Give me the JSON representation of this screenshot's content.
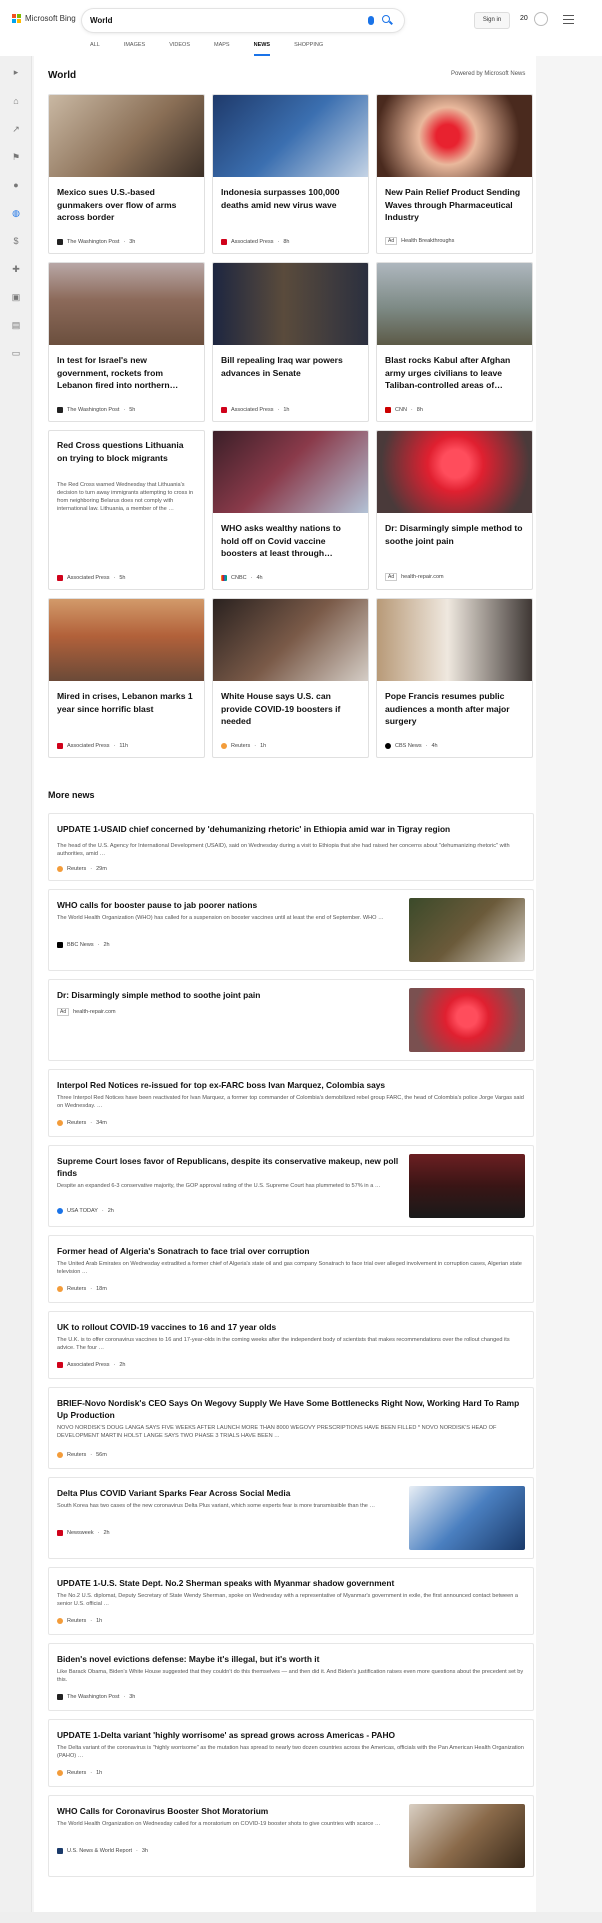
{
  "header": {
    "brand": "Microsoft Bing",
    "query": "World",
    "signin": "Sign in",
    "reward_count": "20"
  },
  "tabs": [
    "ALL",
    "IMAGES",
    "VIDEOS",
    "MAPS",
    "NEWS",
    "SHOPPING"
  ],
  "active_tab": "NEWS",
  "section": {
    "title": "World",
    "powered": "Powered by Microsoft News"
  },
  "cards": [
    {
      "title": "Mexico sues U.S.-based gunmakers over flow of arms across border",
      "source": "The Washington Post",
      "age": "3h",
      "ad": false
    },
    {
      "title": "Indonesia surpasses 100,000 deaths amid new virus wave",
      "source": "Associated Press",
      "age": "8h",
      "ad": false
    },
    {
      "title": "New Pain Relief Product Sending Waves through Pharmaceutical Industry",
      "source": "Health Breakthroughs",
      "age": "",
      "ad": true
    },
    {
      "title": "In test for Israel's new government, rockets from Lebanon fired into northern…",
      "source": "The Washington Post",
      "age": "5h",
      "ad": false
    },
    {
      "title": "Bill repealing Iraq war powers advances in Senate",
      "source": "Associated Press",
      "age": "1h",
      "ad": false
    },
    {
      "title": "Blast rocks Kabul after Afghan army urges civilians to leave Taliban-controlled areas of…",
      "source": "CNN",
      "age": "8h",
      "ad": false
    },
    {
      "title": "Red Cross questions Lithuania on trying to block migrants",
      "snippet": "The Red Cross warned Wednesday that Lithuania's decision to turn away immigrants attempting to cross in from neighboring Belarus does not comply with international law. Lithuania, a member of the …",
      "source": "Associated Press",
      "age": "5h",
      "ad": false
    },
    {
      "title": "WHO asks wealthy nations to hold off on Covid vaccine boosters at least through…",
      "source": "CNBC",
      "age": "4h",
      "ad": false
    },
    {
      "title": "Dr: Disarmingly simple method to soothe joint pain",
      "source": "health-repair.com",
      "age": "",
      "ad": true
    },
    {
      "title": "Mired in crises, Lebanon marks 1 year since horrific blast",
      "source": "Associated Press",
      "age": "11h",
      "ad": false
    },
    {
      "title": "White House says U.S. can provide COVID-19 boosters if needed",
      "source": "Reuters",
      "age": "1h",
      "ad": false
    },
    {
      "title": "Pope Francis resumes public audiences a month after major surgery",
      "source": "CBS News",
      "age": "4h",
      "ad": false
    }
  ],
  "more_title": "More news",
  "news": [
    {
      "title": "UPDATE 1-USAID chief concerned by 'dehumanizing rhetoric' in Ethiopia amid war in Tigray region",
      "snippet": "The head of the U.S. Agency for International Development (USAID), said on Wednesday during a visit to Ethiopia that she had raised her concerns about \"dehumanizing rhetoric\" with authorities, amid …",
      "source": "Reuters",
      "age": "29m"
    },
    {
      "title": "WHO calls for booster pause to jab poorer nations",
      "snippet": "The World Health Organization (WHO) has called for a suspension on booster vaccines until at least the end of September. WHO …",
      "source": "BBC News",
      "age": "2h"
    },
    {
      "title": "Dr: Disarmingly simple method to soothe joint pain",
      "snippet": "",
      "source": "health-repair.com",
      "age": "",
      "ad": true
    },
    {
      "title": "Interpol Red Notices re-issued for top ex-FARC boss Ivan Marquez, Colombia says",
      "snippet": "Three Interpol Red Notices have been reactivated for Ivan Marquez, a former top commander of Colombia's demobilized rebel group FARC, the head of Colombia's police Jorge Vargas said on Wednesday. …",
      "source": "Reuters",
      "age": "34m"
    },
    {
      "title": "Supreme Court loses favor of Republicans, despite its conservative makeup, new poll finds",
      "snippet": "Despite an expanded 6-3 conservative majority, the GOP approval rating of the U.S. Supreme Court has plummeted to 57% in a …",
      "source": "USA TODAY",
      "age": "2h"
    },
    {
      "title": "Former head of Algeria's Sonatrach to face trial over corruption",
      "snippet": "The United Arab Emirates on Wednesday extradited a former chief of Algeria's state oil and gas company Sonatrach to face trial over alleged involvement in corruption cases, Algerian state television …",
      "source": "Reuters",
      "age": "18m"
    },
    {
      "title": "UK to rollout COVID-19 vaccines to 16 and 17 year olds",
      "snippet": "The U.K. is to offer coronavirus vaccines to 16 and 17-year-olds in the coming weeks after the independent body of scientists that makes recommendations over the rollout changed its advice. The four …",
      "source": "Associated Press",
      "age": "2h"
    },
    {
      "title": "BRIEF-Novo Nordisk's CEO Says On Wegovy Supply We Have Some Bottlenecks Right Now, Working Hard To Ramp Up Production",
      "snippet": "NOVO NORDISK'S DOUG LANGA SAYS FIVE WEEKS AFTER LAUNCH MORE THAN 8000 WEGOVY PRESCRIPTIONS HAVE BEEN FILLED * NOVO NORDISK'S HEAD OF DEVELOPMENT MARTIN HOLST LANGE SAYS TWO PHASE 3 TRIALS HAVE BEEN …",
      "source": "Reuters",
      "age": "56m"
    },
    {
      "title": "Delta Plus COVID Variant Sparks Fear Across Social Media",
      "snippet": "South Korea has two cases of the new coronavirus Delta Plus variant, which some experts fear is more transmissible than the …",
      "source": "Newsweek",
      "age": "2h"
    },
    {
      "title": "UPDATE 1-U.S. State Dept. No.2 Sherman speaks with Myanmar shadow government",
      "snippet": "The No.2 U.S. diplomat, Deputy Secretary of State Wendy Sherman, spoke on Wednesday with a representative of Myanmar's government in exile, the first announced contact between a senior U.S. official …",
      "source": "Reuters",
      "age": "1h"
    },
    {
      "title": "Biden's novel evictions defense: Maybe it's illegal, but it's worth it",
      "snippet": "Like Barack Obama, Biden's White House suggested that they couldn't do this themselves — and then did it. And Biden's justification raises even more questions about the precedent set by this.",
      "source": "The Washington Post",
      "age": "3h"
    },
    {
      "title": "UPDATE 1-Delta variant 'highly worrisome' as spread grows across Americas - PAHO",
      "snippet": "The Delta variant of the coronavirus is \"highly worrisome\" as the mutation has spread to nearly two dozen countries across the Americas, officials with the Pan American Health Organization (PAHO) …",
      "source": "Reuters",
      "age": "1h"
    },
    {
      "title": "WHO Calls for Coronavirus Booster Shot Moratorium",
      "snippet": "The World Health Organization on Wednesday called for a moratorium on COVID-19 booster shots to give countries with scarce …",
      "source": "U.S. News & World Report",
      "age": "3h"
    }
  ],
  "colors": {
    "accent": "#1a73e8",
    "reuters": "#f39c3a",
    "ap": "#d0021b",
    "cnn": "#cc0000"
  }
}
